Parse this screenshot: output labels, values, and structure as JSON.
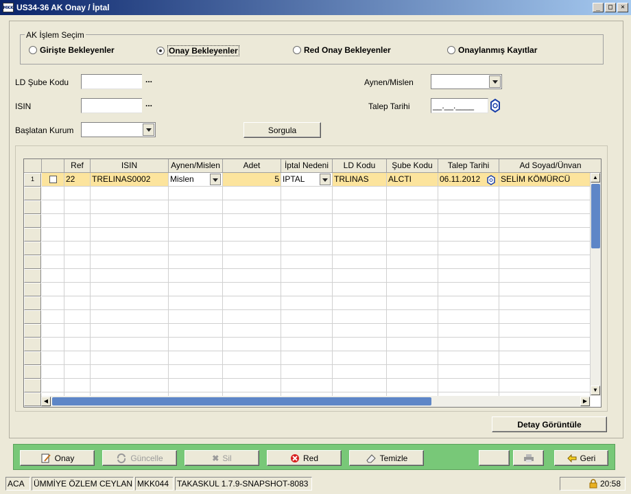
{
  "window": {
    "title": "US34-36 AK Onay / İptal",
    "logo_text": "MKK"
  },
  "selection": {
    "legend": "AK İşlem Seçim",
    "options": [
      {
        "label": "Girişte Bekleyenler",
        "selected": false
      },
      {
        "label": "Onay Bekleyenler",
        "selected": true
      },
      {
        "label": "Red Onay Bekleyenler",
        "selected": false
      },
      {
        "label": "Onaylanmış Kayıtlar",
        "selected": false
      }
    ]
  },
  "form": {
    "ld_sube_label": "LD Şube Kodu",
    "ld_sube_value": "",
    "isin_label": "ISIN",
    "isin_value": "",
    "baslatan_label": "Başlatan Kurum",
    "baslatan_value": "",
    "aynen_label": "Aynen/Mislen",
    "aynen_value": "",
    "talep_label": "Talep Tarihi",
    "talep_placeholder": "__.__.____",
    "dots": "...",
    "sorgula": "Sorgula"
  },
  "table": {
    "columns": [
      "",
      "Ref",
      "ISIN",
      "Aynen/Mislen",
      "Adet",
      "İptal Nedeni",
      "LD Kodu",
      "Şube Kodu",
      "Talep Tarihi",
      "Ad Soyad/Ünvan"
    ],
    "rows": [
      {
        "num": "1",
        "ref": "22",
        "isin": "TRELINAS0002",
        "aynen": "Mislen",
        "adet": "5",
        "iptal": "IPTAL",
        "ld": "TRLINAS",
        "sube": "ALCTI",
        "tarih": "06.11.2012",
        "ad": "SELİM KÖMÜRCÜ"
      }
    ]
  },
  "detay_button": "Detay Görüntüle",
  "actions": {
    "onay": "Onay",
    "guncelle": "Güncelle",
    "sil": "Sil",
    "red": "Red",
    "temizle": "Temizle",
    "geri": "Geri"
  },
  "status": {
    "code": "ACA",
    "user": "ÜMMİYE ÖZLEM CEYLAN",
    "org": "MKK044",
    "version": "TAKASKUL 1.7.9-SNAPSHOT-8083",
    "time": "20:58"
  },
  "colors": {
    "title_bar": "#0a246a",
    "selected_row": "#fce49d",
    "action_bar": "#78c878"
  }
}
